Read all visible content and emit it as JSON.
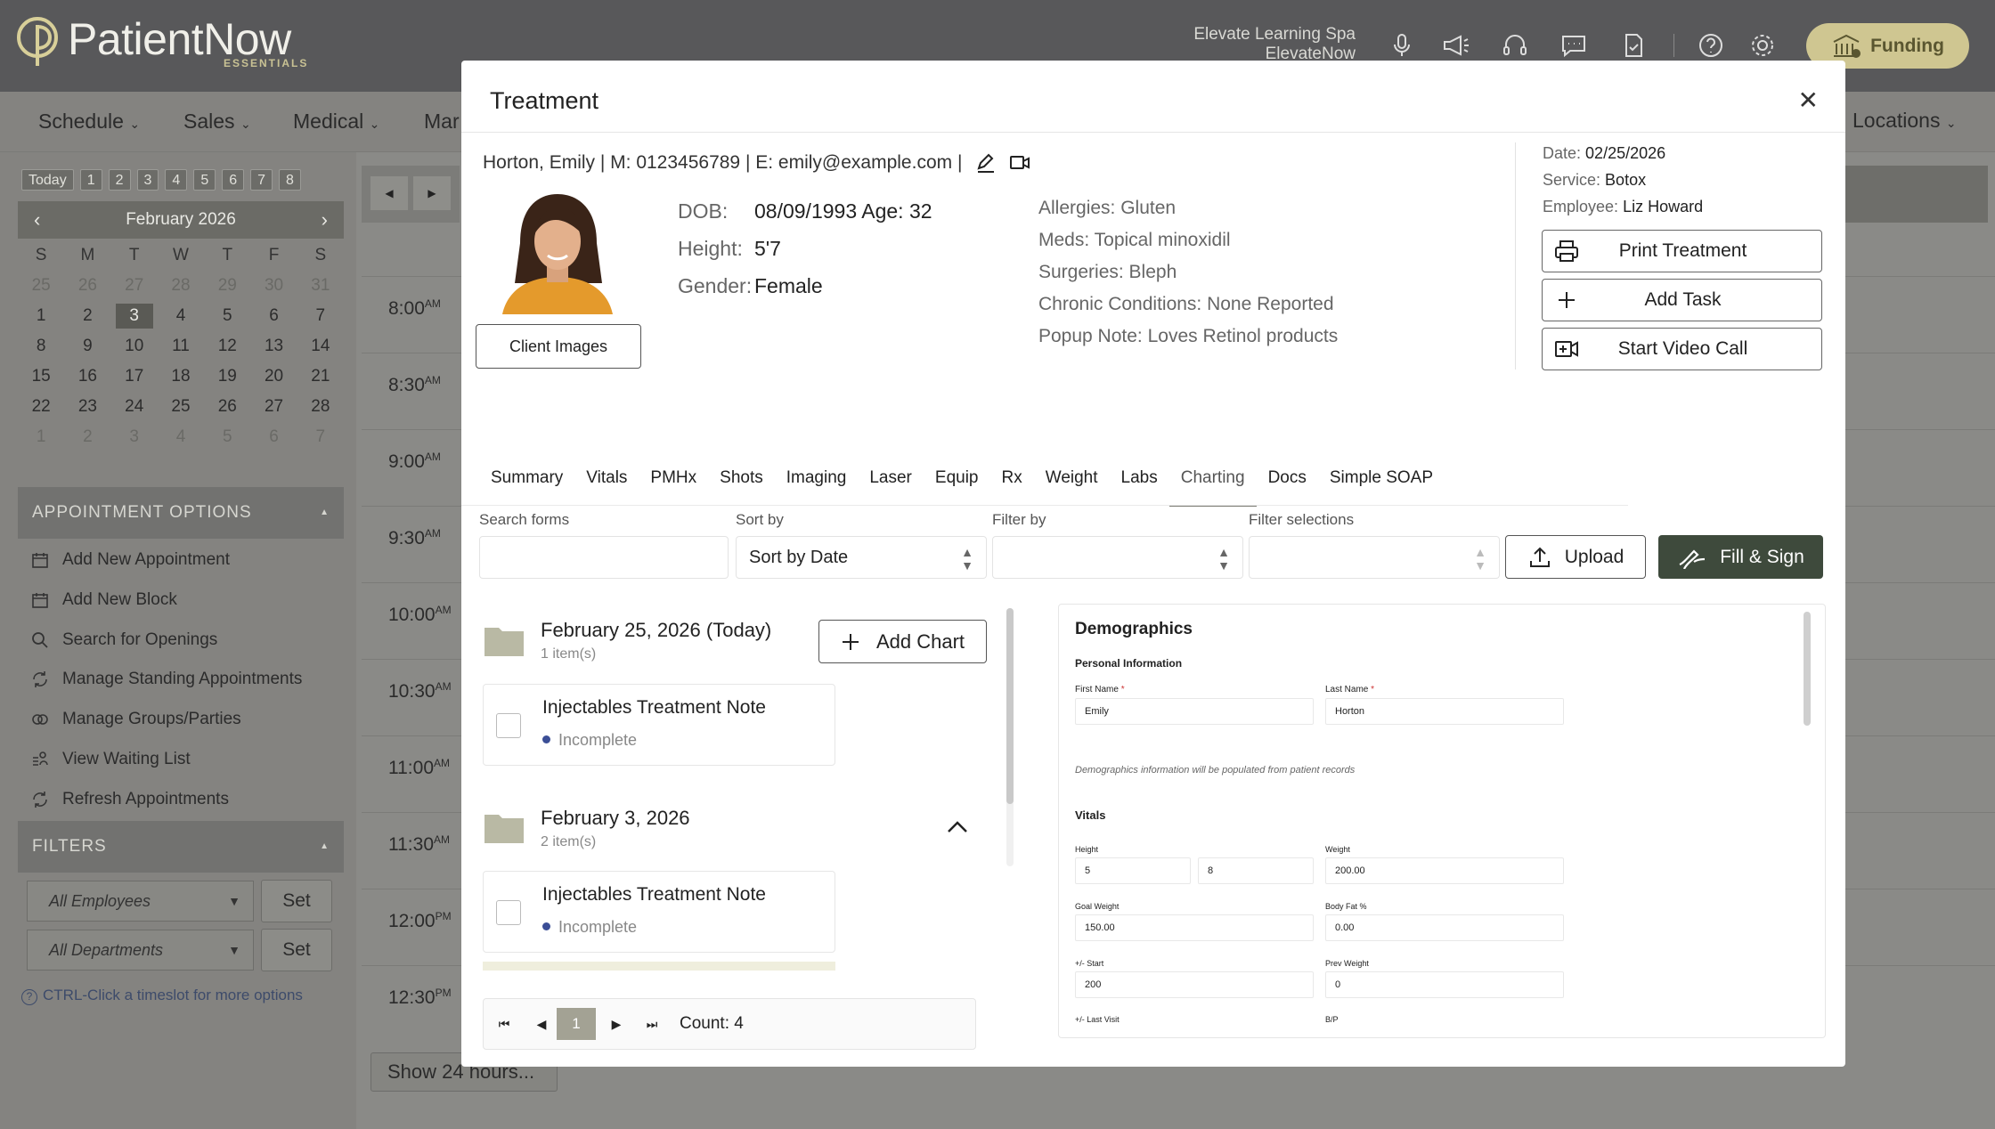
{
  "app": {
    "brand": "PatientNow",
    "brand_sub": "ESSENTIALS",
    "location_line1": "Elevate Learning Spa",
    "location_line2": "ElevateNow",
    "funding_label": "Funding"
  },
  "topbar_icons": [
    "microphone-icon",
    "megaphone-icon",
    "headset-icon",
    "chat-icon",
    "clipboard-check-icon",
    "help-icon",
    "gear-icon"
  ],
  "nav": {
    "items": [
      "Schedule",
      "Sales",
      "Medical",
      "Mar"
    ],
    "locations": "Locations"
  },
  "calendar": {
    "today_label": "Today",
    "week_buttons": [
      "1",
      "2",
      "3",
      "4",
      "5",
      "6",
      "7",
      "8"
    ],
    "month": "February 2026",
    "dow": [
      "S",
      "M",
      "T",
      "W",
      "T",
      "F",
      "S"
    ],
    "days": [
      [
        "25",
        "26",
        "27",
        "28",
        "29",
        "30",
        "31"
      ],
      [
        "1",
        "2",
        "3",
        "4",
        "5",
        "6",
        "7"
      ],
      [
        "8",
        "9",
        "10",
        "11",
        "12",
        "13",
        "14"
      ],
      [
        "15",
        "16",
        "17",
        "18",
        "19",
        "20",
        "21"
      ],
      [
        "22",
        "23",
        "24",
        "25",
        "26",
        "27",
        "28"
      ],
      [
        "1",
        "2",
        "3",
        "4",
        "5",
        "6",
        "7"
      ]
    ],
    "selected_day": "3"
  },
  "appointment_options": {
    "title": "APPOINTMENT OPTIONS",
    "items": [
      "Add New Appointment",
      "Add New Block",
      "Search for Openings",
      "Manage Standing Appointments",
      "Manage Groups/Parties",
      "View Waiting List",
      "Refresh Appointments"
    ]
  },
  "filters": {
    "title": "FILTERS",
    "employees": "All Employees",
    "departments": "All Departments",
    "set_label": "Set",
    "hint": "CTRL-Click a timeslot for more options"
  },
  "schedule": {
    "times": [
      [
        "8:00",
        "AM"
      ],
      [
        "8:30",
        "AM"
      ],
      [
        "9:00",
        "AM"
      ],
      [
        "9:30",
        "AM"
      ],
      [
        "10:00",
        "AM"
      ],
      [
        "10:30",
        "AM"
      ],
      [
        "11:00",
        "AM"
      ],
      [
        "11:30",
        "AM"
      ],
      [
        "12:00",
        "PM"
      ],
      [
        "12:30",
        "PM"
      ]
    ],
    "show24": "Show 24 hours..."
  },
  "modal": {
    "title": "Treatment",
    "patient_line": "Horton, Emily | M: 0123456789 | E: emily@example.com |",
    "client_images": "Client Images",
    "dob_label": "DOB:",
    "dob": "08/09/1993 Age: 32",
    "height_label": "Height:",
    "height": "5'7",
    "gender_label": "Gender:",
    "gender": "Female",
    "medical": [
      "Allergies: Gluten",
      "Meds: Topical minoxidil",
      "Surgeries: Bleph",
      "Chronic Conditions: None Reported",
      "Popup Note: Loves Retinol products"
    ],
    "date_label": "Date:",
    "date": "02/25/2026",
    "service_label": "Service:",
    "service": "Botox",
    "employee_label": "Employee:",
    "employee": "Liz Howard",
    "print": "Print Treatment",
    "add_task": "Add Task",
    "video": "Start Video Call",
    "tabs": [
      "Summary",
      "Vitals",
      "PMHx",
      "Shots",
      "Imaging",
      "Laser",
      "Equip",
      "Rx",
      "Weight",
      "Labs",
      "Charting",
      "Docs",
      "Simple SOAP"
    ],
    "active_tab": "Charting",
    "search_label": "Search forms",
    "sort_label": "Sort by",
    "sort_value": "Sort by Date",
    "filter_label": "Filter by",
    "filter_sel_label": "Filter selections",
    "upload": "Upload",
    "fill_sign": "Fill & Sign",
    "groups": [
      {
        "date": "February 25, 2026 (Today)",
        "count": "1 item(s)"
      },
      {
        "date": "February 3, 2026",
        "count": "2 item(s)"
      }
    ],
    "add_chart": "Add Chart",
    "note_title": "Injectables Treatment Note",
    "note_status": "Incomplete",
    "pager_current": "1",
    "pager_count": "Count: 4"
  },
  "preview": {
    "title": "Demographics",
    "section1": "Personal Information",
    "first_name_label": "First Name",
    "first_name": "Emily",
    "last_name_label": "Last Name",
    "last_name": "Horton",
    "required": "*",
    "note": "Demographics information will be populated from patient records",
    "vitals": "Vitals",
    "height_label": "Height",
    "height_ft": "5",
    "height_in": "8",
    "weight_label": "Weight",
    "weight": "200.00",
    "goal_label": "Goal Weight",
    "goal": "150.00",
    "bodyfat_label": "Body Fat %",
    "bodyfat": "0.00",
    "start_label": "+/- Start",
    "start": "200",
    "prev_label": "Prev Weight",
    "prev": "0",
    "last_label": "+/- Last Visit",
    "bp_label": "B/P"
  }
}
